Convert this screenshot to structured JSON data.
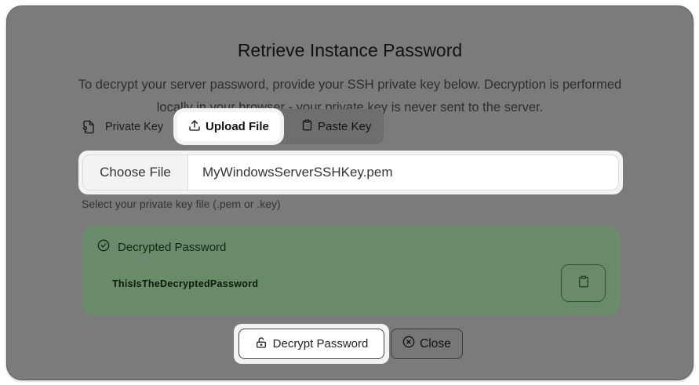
{
  "dialog": {
    "title": "Retrieve Instance Password",
    "description_line1": "To decrypt your server password, provide your SSH private key below. Decryption is performed",
    "description_line2": "locally in your browser - your private key is never sent to the server."
  },
  "private_key": {
    "label": "Private Key",
    "icon": "file-key-icon",
    "tabs": [
      {
        "label": "Upload File",
        "icon": "upload-icon",
        "active": true
      },
      {
        "label": "Paste Key",
        "icon": "clipboard-icon",
        "active": false
      }
    ]
  },
  "file_input": {
    "button_label": "Choose File",
    "filename": "MyWindowsServerSSHKey.pem",
    "helper_text": "Select your private key file (.pem or .key)"
  },
  "result": {
    "heading": "Decrypted Password",
    "icon": "check-circle-icon",
    "password": "ThisIsTheDecryptedPassword",
    "copy_icon": "clipboard-icon"
  },
  "actions": {
    "decrypt_label": "Decrypt Password",
    "decrypt_icon": "unlock-icon",
    "close_label": "Close",
    "close_icon": "x-circle-icon"
  }
}
